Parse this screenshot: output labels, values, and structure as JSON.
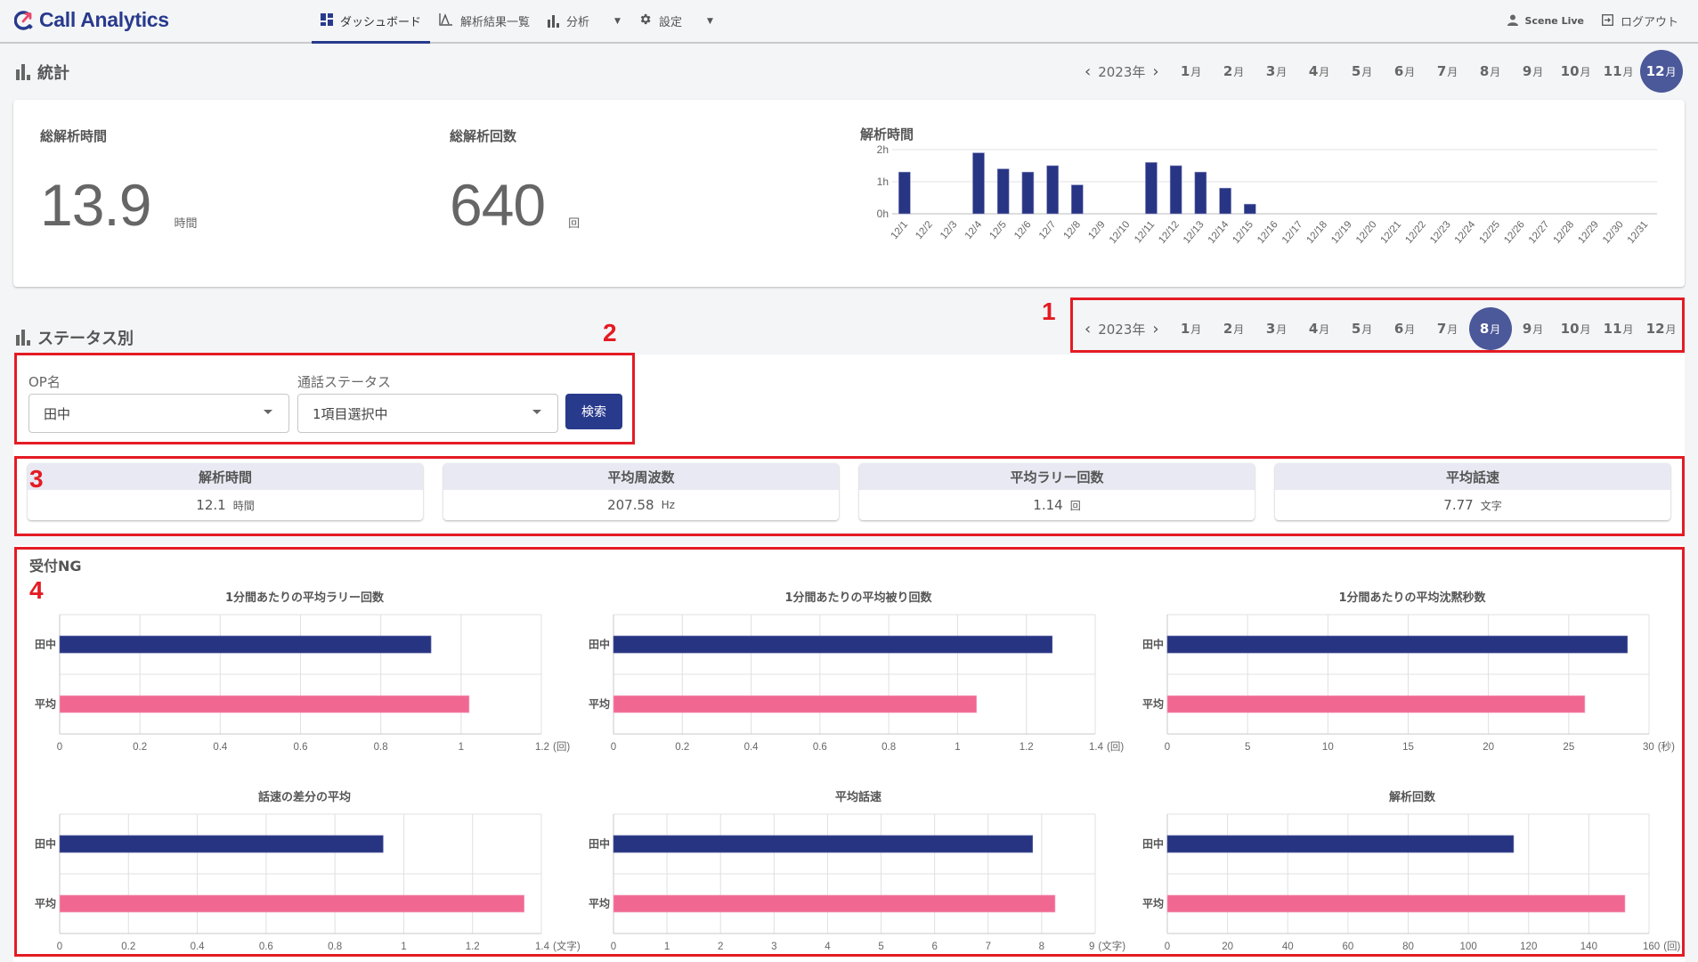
{
  "app": {
    "title": "Call Analytics",
    "brand_color": "#283a8c",
    "accent_pink": "#e8496b"
  },
  "nav": {
    "items": [
      {
        "label": "ダッシュボード",
        "icon": "dashboard-icon",
        "active": true
      },
      {
        "label": "解析結果一覧",
        "icon": "line-chart-icon",
        "active": false
      },
      {
        "label": "分析",
        "icon": "bar-chart-icon",
        "active": false,
        "dropdown": true
      },
      {
        "label": "設定",
        "icon": "gear-icon",
        "active": false,
        "dropdown": true
      }
    ],
    "user_name": "Scene Live",
    "logout_label": "ログアウト"
  },
  "stats_section": {
    "title": "統計",
    "year_label": "2023年",
    "months": [
      "1",
      "2",
      "3",
      "4",
      "5",
      "6",
      "7",
      "8",
      "9",
      "10",
      "11",
      "12"
    ],
    "month_suffix": "月",
    "selected_month": "12",
    "total_time": {
      "label": "総解析時間",
      "value": "13.9",
      "unit": "時間"
    },
    "total_count": {
      "label": "総解析回数",
      "value": "640",
      "unit": "回"
    }
  },
  "status_section": {
    "title": "ステータス別",
    "year_label": "2023年",
    "months": [
      "1",
      "2",
      "3",
      "4",
      "5",
      "6",
      "7",
      "8",
      "9",
      "10",
      "11",
      "12"
    ],
    "month_suffix": "月",
    "selected_month": "8",
    "filters": {
      "op_label": "OP名",
      "op_value": "田中",
      "status_label": "通話ステータス",
      "status_value": "1項目選択中",
      "search_label": "検索"
    },
    "metrics": [
      {
        "label": "解析時間",
        "value": "12.1",
        "unit": "時間"
      },
      {
        "label": "平均周波数",
        "value": "207.58",
        "unit": "Hz"
      },
      {
        "label": "平均ラリー回数",
        "value": "1.14",
        "unit": "回"
      },
      {
        "label": "平均話速",
        "value": "7.77",
        "unit": "文字"
      }
    ],
    "group_title": "受付NG"
  },
  "annotations": [
    "1",
    "2",
    "3",
    "4"
  ],
  "chart_data": [
    {
      "type": "bar",
      "title": "解析時間",
      "categories": [
        "12/1",
        "12/2",
        "12/3",
        "12/4",
        "12/5",
        "12/6",
        "12/7",
        "12/8",
        "12/9",
        "12/10",
        "12/11",
        "12/12",
        "12/13",
        "12/14",
        "12/15",
        "12/16",
        "12/17",
        "12/18",
        "12/19",
        "12/20",
        "12/21",
        "12/22",
        "12/23",
        "12/24",
        "12/25",
        "12/26",
        "12/27",
        "12/28",
        "12/29",
        "12/30",
        "12/31"
      ],
      "values": [
        1.3,
        0,
        0,
        1.9,
        1.4,
        1.3,
        1.5,
        0.9,
        0,
        0,
        1.6,
        1.5,
        1.3,
        0.8,
        0.3,
        0,
        0,
        0,
        0,
        0,
        0,
        0,
        0,
        0,
        0,
        0,
        0,
        0,
        0,
        0,
        0
      ],
      "ylabel": "",
      "xlabel": "",
      "yticks": [
        "0h",
        "1h",
        "2h"
      ],
      "ylim": [
        0,
        2
      ],
      "grid": true,
      "color": "#283584"
    },
    {
      "type": "bar",
      "orientation": "horizontal",
      "title": "1分間あたりの平均ラリー回数",
      "categories": [
        "田中",
        "平均"
      ],
      "values": [
        0.925,
        1.02
      ],
      "xlim": [
        0,
        1.2
      ],
      "xticks": [
        "0",
        "0.2",
        "0.4",
        "0.6",
        "0.8",
        "1",
        "1.2"
      ],
      "unit": "(回)",
      "grid": true
    },
    {
      "type": "bar",
      "orientation": "horizontal",
      "title": "1分間あたりの平均被り回数",
      "categories": [
        "田中",
        "平均"
      ],
      "values": [
        1.275,
        1.055
      ],
      "xlim": [
        0,
        1.4
      ],
      "xticks": [
        "0",
        "0.2",
        "0.4",
        "0.6",
        "0.8",
        "1",
        "1.2",
        "1.4"
      ],
      "unit": "(回)",
      "grid": true
    },
    {
      "type": "bar",
      "orientation": "horizontal",
      "title": "1分間あたりの平均沈黙秒数",
      "categories": [
        "田中",
        "平均"
      ],
      "values": [
        28.65,
        26.0
      ],
      "xlim": [
        0,
        30
      ],
      "xticks": [
        "0",
        "5",
        "10",
        "15",
        "20",
        "25",
        "30"
      ],
      "unit": "(秒)",
      "grid": true
    },
    {
      "type": "bar",
      "orientation": "horizontal",
      "title": "話速の差分の平均",
      "categories": [
        "田中",
        "平均"
      ],
      "values": [
        0.94,
        1.35
      ],
      "xlim": [
        0,
        1.4
      ],
      "xticks": [
        "0",
        "0.2",
        "0.4",
        "0.6",
        "0.8",
        "1",
        "1.2",
        "1.4"
      ],
      "unit": "(文字)",
      "grid": true
    },
    {
      "type": "bar",
      "orientation": "horizontal",
      "title": "平均話速",
      "categories": [
        "田中",
        "平均"
      ],
      "values": [
        7.83,
        8.25
      ],
      "xlim": [
        0,
        9
      ],
      "xticks": [
        "0",
        "1",
        "2",
        "3",
        "4",
        "5",
        "6",
        "7",
        "8",
        "9"
      ],
      "unit": "(文字)",
      "grid": true
    },
    {
      "type": "bar",
      "orientation": "horizontal",
      "title": "解析回数",
      "categories": [
        "田中",
        "平均"
      ],
      "values": [
        115,
        152
      ],
      "xlim": [
        0,
        160
      ],
      "xticks": [
        "0",
        "20",
        "40",
        "60",
        "80",
        "100",
        "120",
        "140",
        "160"
      ],
      "unit": "(回)",
      "grid": true
    }
  ],
  "series_colors": {
    "operator": "#273482",
    "average": "#f06892"
  }
}
